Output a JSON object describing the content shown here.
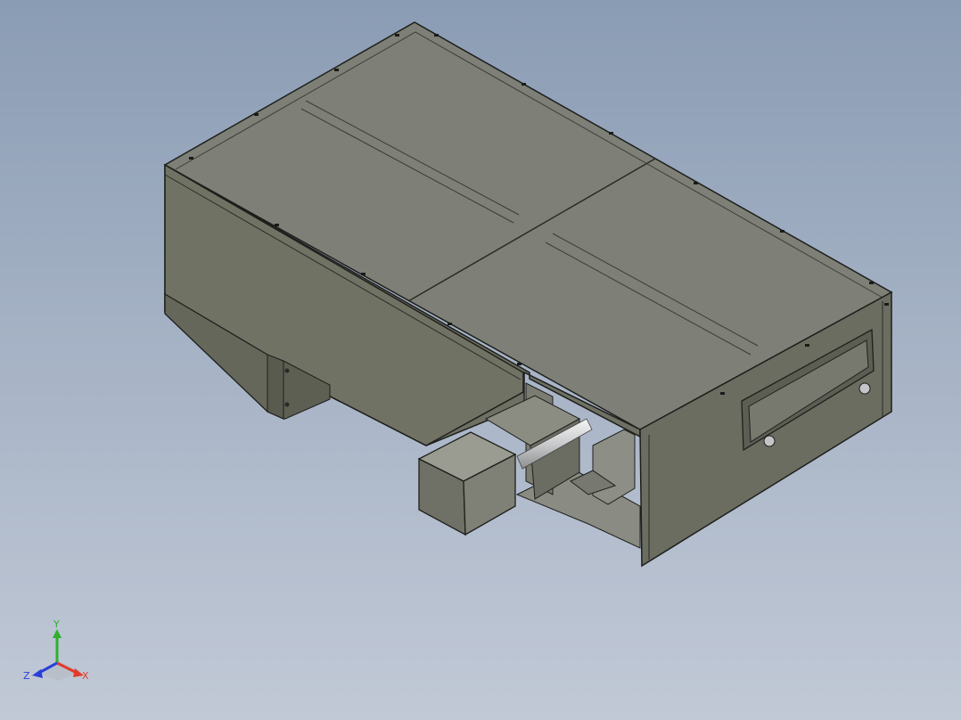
{
  "viewport": {
    "background_top": "#8a9cb4",
    "background_bottom": "#c1c9d6",
    "model_colors": {
      "top_face": "#7d7f76",
      "side_face": "#6e7063",
      "front_face": "#6a6c60",
      "edge": "#1e1f1c",
      "shaft": "#d8dadb"
    }
  },
  "triad": {
    "x_label": "X",
    "y_label": "Y",
    "z_label": "Z",
    "x_color": "#e23a2c",
    "y_color": "#2fb02f",
    "z_color": "#2a3fd8"
  }
}
